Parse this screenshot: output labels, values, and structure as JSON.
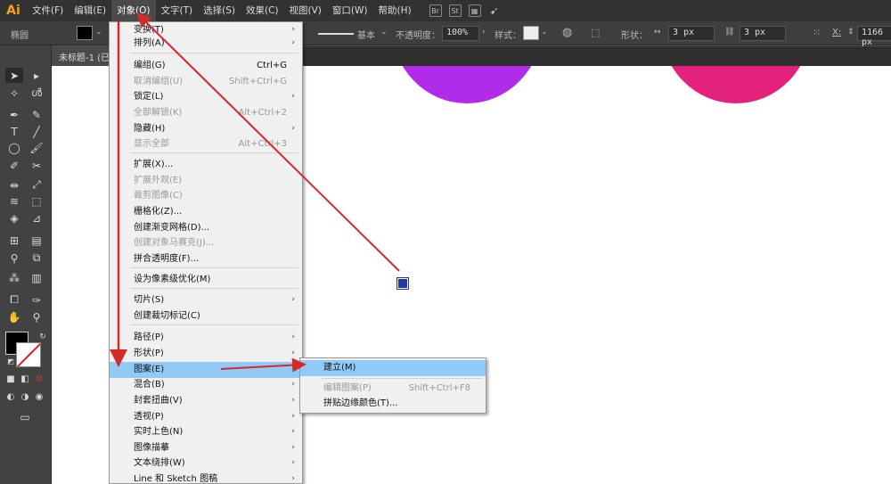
{
  "app": {
    "logo": "Ai"
  },
  "menubar": {
    "items": [
      "文件(F)",
      "编辑(E)",
      "对象(O)",
      "文字(T)",
      "选择(S)",
      "效果(C)",
      "视图(V)",
      "窗口(W)",
      "帮助(H)"
    ],
    "icons": [
      "Br",
      "St"
    ]
  },
  "controlbar": {
    "shape_label": "椭圆",
    "stroke_style_label": "基本",
    "opacity_label": "不透明度：",
    "opacity_value": "100%",
    "style_label": "样式：",
    "shape_props_label": "形状：",
    "width_value": "3 px",
    "height_value": "3 px",
    "x_label": "X:",
    "x_value": "1166 px"
  },
  "document": {
    "tab_title": "未标题-1 (已"
  },
  "object_menu": {
    "items": [
      {
        "label": "变换(T)",
        "shortcut": "",
        "submenu": true,
        "disabled": false
      },
      {
        "label": "排列(A)",
        "shortcut": "",
        "submenu": true,
        "disabled": false
      },
      {
        "label": "编组(G)",
        "shortcut": "Ctrl+G",
        "submenu": false,
        "disabled": false
      },
      {
        "label": "取消编组(U)",
        "shortcut": "Shift+Ctrl+G",
        "submenu": false,
        "disabled": true
      },
      {
        "label": "锁定(L)",
        "shortcut": "",
        "submenu": true,
        "disabled": false
      },
      {
        "label": "全部解锁(K)",
        "shortcut": "Alt+Ctrl+2",
        "submenu": false,
        "disabled": true
      },
      {
        "label": "隐藏(H)",
        "shortcut": "",
        "submenu": true,
        "disabled": false
      },
      {
        "label": "显示全部",
        "shortcut": "Alt+Ctrl+3",
        "submenu": false,
        "disabled": true
      },
      {
        "label": "扩展(X)...",
        "shortcut": "",
        "submenu": false,
        "disabled": false
      },
      {
        "label": "扩展外观(E)",
        "shortcut": "",
        "submenu": false,
        "disabled": true
      },
      {
        "label": "裁剪图像(C)",
        "shortcut": "",
        "submenu": false,
        "disabled": true
      },
      {
        "label": "栅格化(Z)...",
        "shortcut": "",
        "submenu": false,
        "disabled": false
      },
      {
        "label": "创建渐变网格(D)...",
        "shortcut": "",
        "submenu": false,
        "disabled": false
      },
      {
        "label": "创建对象马赛克(J)...",
        "shortcut": "",
        "submenu": false,
        "disabled": true
      },
      {
        "label": "拼合透明度(F)...",
        "shortcut": "",
        "submenu": false,
        "disabled": false
      },
      {
        "label": "设为像素级优化(M)",
        "shortcut": "",
        "submenu": false,
        "disabled": false
      },
      {
        "label": "切片(S)",
        "shortcut": "",
        "submenu": true,
        "disabled": false
      },
      {
        "label": "创建裁切标记(C)",
        "shortcut": "",
        "submenu": false,
        "disabled": false
      },
      {
        "label": "路径(P)",
        "shortcut": "",
        "submenu": true,
        "disabled": false
      },
      {
        "label": "形状(P)",
        "shortcut": "",
        "submenu": true,
        "disabled": false
      },
      {
        "label": "图案(E)",
        "shortcut": "",
        "submenu": true,
        "disabled": false,
        "highlighted": true
      },
      {
        "label": "混合(B)",
        "shortcut": "",
        "submenu": true,
        "disabled": false
      },
      {
        "label": "封套扭曲(V)",
        "shortcut": "",
        "submenu": true,
        "disabled": false
      },
      {
        "label": "透视(P)",
        "shortcut": "",
        "submenu": true,
        "disabled": false
      },
      {
        "label": "实时上色(N)",
        "shortcut": "",
        "submenu": true,
        "disabled": false
      },
      {
        "label": "图像描摹",
        "shortcut": "",
        "submenu": true,
        "disabled": false
      },
      {
        "label": "文本绕排(W)",
        "shortcut": "",
        "submenu": true,
        "disabled": false
      },
      {
        "label": "Line 和 Sketch 图稿",
        "shortcut": "",
        "submenu": true,
        "disabled": false
      }
    ]
  },
  "pattern_submenu": {
    "items": [
      {
        "label": "建立(M)",
        "shortcut": "",
        "disabled": false,
        "highlighted": true
      },
      {
        "label": "编辑图案(P)",
        "shortcut": "Shift+Ctrl+F8",
        "disabled": true
      },
      {
        "label": "拼贴边缘颜色(T)...",
        "shortcut": "",
        "disabled": false
      }
    ]
  },
  "colors": {
    "circle_purple": "#b02cea",
    "circle_pink": "#e3237b",
    "annotation_arrow": "#d42a2a",
    "menu_highlight": "#91c9f7"
  }
}
